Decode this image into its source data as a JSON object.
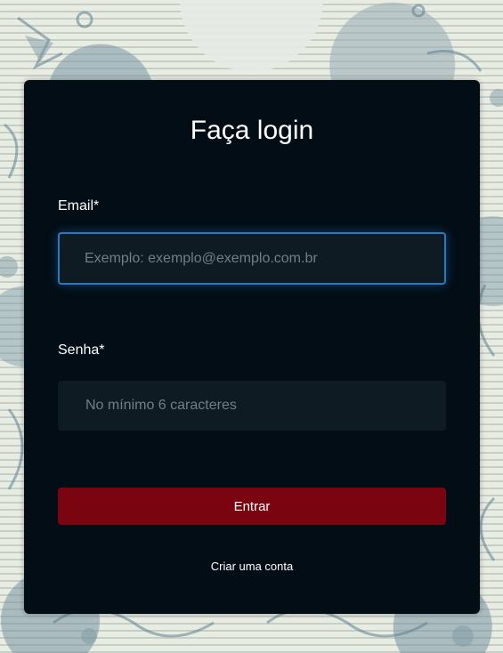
{
  "login": {
    "title": "Faça login",
    "email_label": "Email*",
    "email_placeholder": "Exemplo: exemplo@exemplo.com.br",
    "email_value": "",
    "password_label": "Senha*",
    "password_placeholder": "No mínimo 6 caracteres",
    "password_value": "",
    "submit_label": "Entrar",
    "create_account_label": "Criar uma conta"
  },
  "colors": {
    "card_background": "#020d15",
    "input_background": "#0f1b23",
    "focus_border": "#2a78c4",
    "button_background": "#7a0510",
    "text": "#ffffff"
  }
}
